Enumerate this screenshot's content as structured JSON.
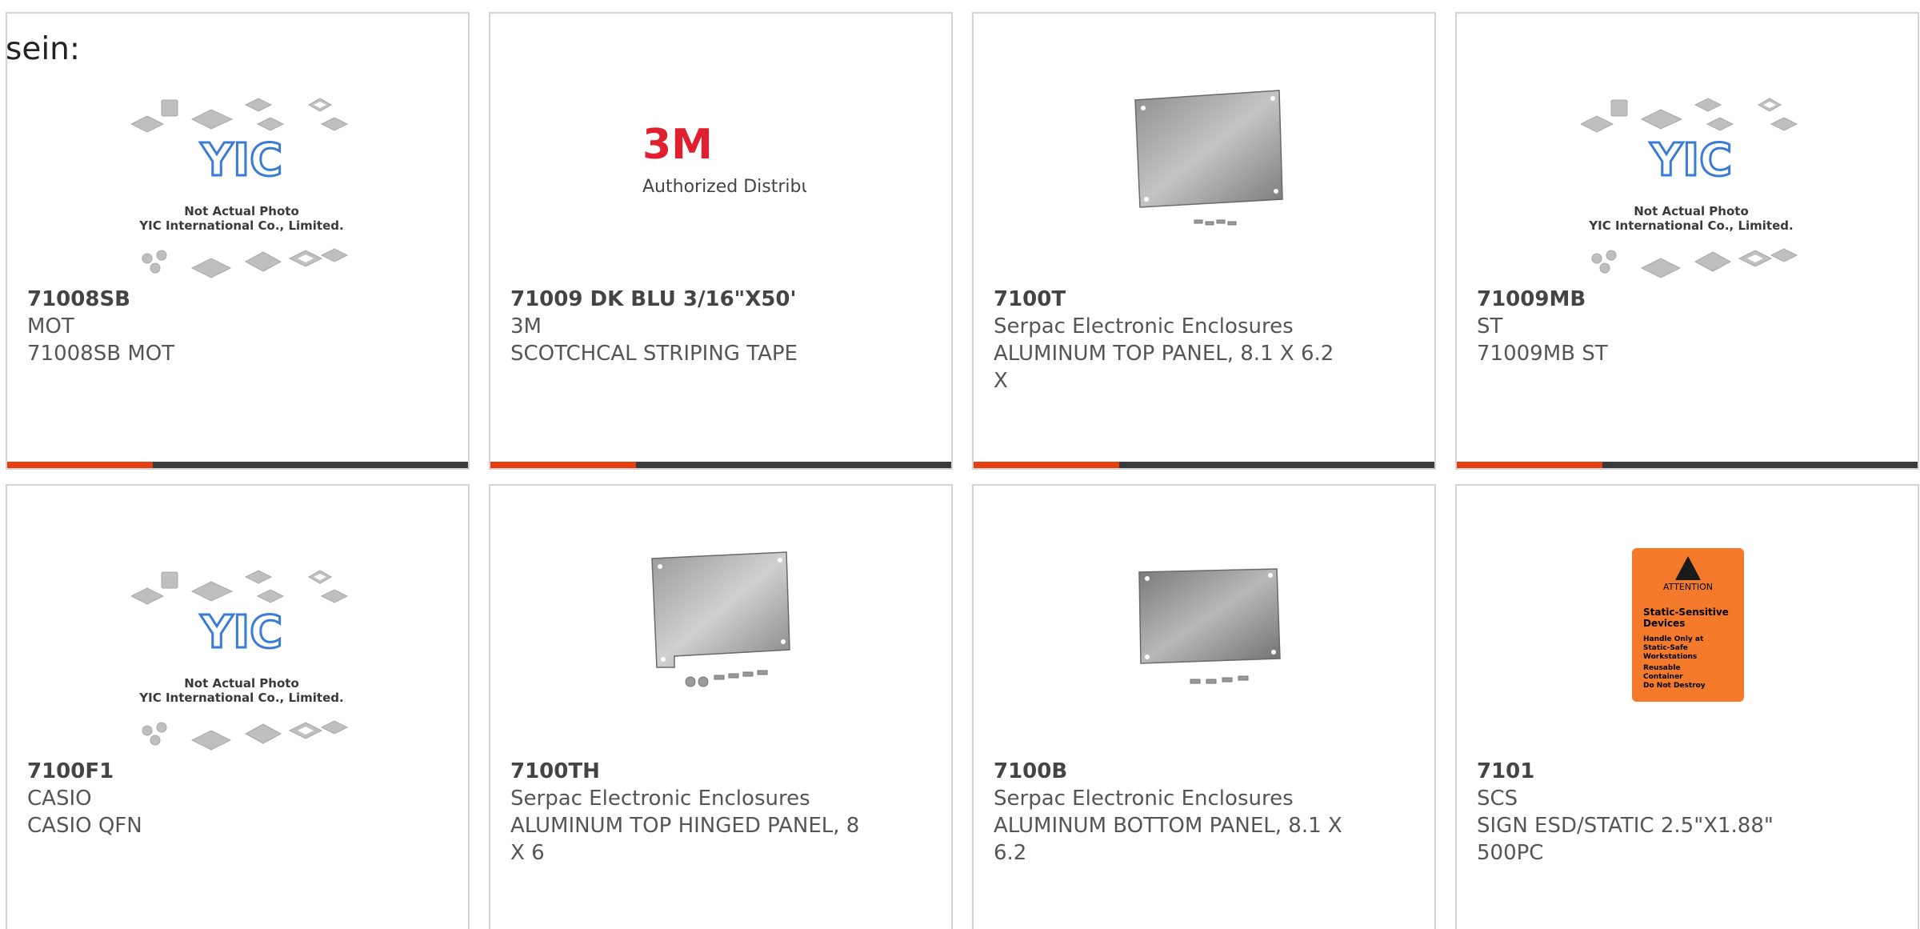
{
  "fragment_text": "sein:",
  "accent_color": "#e53f12",
  "products": [
    {
      "part_number": "71008SB",
      "manufacturer": "MOT",
      "description": "71008SB MOT",
      "image": "yic-placeholder-image",
      "placeholder_caption_1": "Not Actual Photo",
      "placeholder_caption_2": "YIC International Co., Limited."
    },
    {
      "part_number": "71009 DK BLU 3/16\"X50'",
      "manufacturer": "3M",
      "description": "SCOTCHCAL STRIPING TAPE",
      "image": "3m-logo-image",
      "logo_text": "3M",
      "logo_subtext": "Authorized Distributor"
    },
    {
      "part_number": "7100T",
      "manufacturer": "Serpac Electronic Enclosures",
      "description": "ALUMINUM TOP PANEL, 8.1 X 6.2 X",
      "image": "aluminum-panel-image"
    },
    {
      "part_number": "71009MB",
      "manufacturer": "ST",
      "description": "71009MB ST",
      "image": "yic-placeholder-image",
      "placeholder_caption_1": "Not Actual Photo",
      "placeholder_caption_2": "YIC International Co., Limited."
    },
    {
      "part_number": "7100F1",
      "manufacturer": "CASIO",
      "description": "CASIO QFN",
      "image": "yic-placeholder-image",
      "placeholder_caption_1": "Not Actual Photo",
      "placeholder_caption_2": "YIC International Co., Limited."
    },
    {
      "part_number": "7100TH",
      "manufacturer": "Serpac Electronic Enclosures",
      "description": "ALUMINUM TOP HINGED PANEL, 8 X 6",
      "image": "hinged-aluminum-panel-image"
    },
    {
      "part_number": "7100B",
      "manufacturer": "Serpac Electronic Enclosures",
      "description": "ALUMINUM BOTTOM PANEL, 8.1 X 6.2",
      "image": "aluminum-panel-image"
    },
    {
      "part_number": "7101",
      "manufacturer": "SCS",
      "description": "SIGN ESD/STATIC 2.5\"X1.88\" 500PC",
      "image": "esd-sign-image",
      "sign_lines": [
        "ATTENTION",
        "Static-Sensitive",
        "Devices",
        "Handle Only at",
        "Static-Safe",
        "Workstations",
        "Reusable",
        "Container",
        "Do Not Destroy"
      ]
    }
  ]
}
